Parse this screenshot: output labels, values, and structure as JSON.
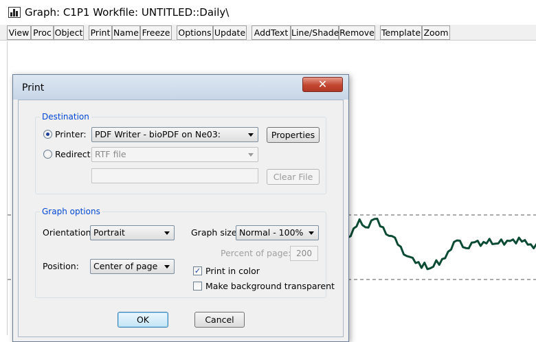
{
  "window": {
    "title": "Graph: C1P1   Workfile: UNTITLED::Daily\\"
  },
  "toolbar": {
    "buttons": [
      "View",
      "Proc",
      "Object",
      "Print",
      "Name",
      "Freeze",
      "Options",
      "Update",
      "AddText",
      "Line/Shade",
      "Remove",
      "Template",
      "Zoom"
    ]
  },
  "chart_data": {
    "type": "line",
    "series": [
      {
        "values": [
          0.55,
          0.62,
          0.7,
          0.78,
          0.85,
          0.8,
          0.72,
          0.76,
          0.83,
          0.9,
          0.86,
          0.78,
          0.72,
          0.65,
          0.58,
          0.62,
          0.55,
          0.48,
          0.4,
          0.32,
          0.25,
          0.28,
          0.22,
          0.18,
          0.15,
          0.1,
          0.14,
          0.08,
          0.05,
          0.12,
          0.18,
          0.15,
          0.2,
          0.26,
          0.32,
          0.4,
          0.48,
          0.55,
          0.5,
          0.44,
          0.38,
          0.42,
          0.47,
          0.52,
          0.5,
          0.46,
          0.48,
          0.5,
          0.53,
          0.49,
          0.45,
          0.5,
          0.52,
          0.48,
          0.5,
          0.54,
          0.52,
          0.5,
          0.55,
          0.53,
          0.51,
          0.48,
          0.44,
          0.42,
          0.45
        ]
      }
    ],
    "reference_lines": "dashed",
    "line_color": "#0b4a33",
    "grid": false
  },
  "dialog": {
    "title": "Print",
    "close_glyph": "✕",
    "destination": {
      "label": "Destination",
      "printer_label": "Printer:",
      "printer_value": "PDF Writer - bioPDF on Ne03:",
      "properties_button": "Properties",
      "redirect_label": "Redirect:",
      "redirect_value": "RTF file",
      "file_path": "",
      "clear_file_button": "Clear File"
    },
    "graph_options": {
      "label": "Graph options",
      "orientation_label": "Orientation:",
      "orientation_value": "Portrait",
      "graph_size_label": "Graph size:",
      "graph_size_value": "Normal - 100%",
      "percent_label": "Percent of page:",
      "percent_value": "200",
      "position_label": "Position:",
      "position_value": "Center of page",
      "print_in_color_label": "Print in color",
      "print_in_color_checked": true,
      "transparent_label": "Make background transparent",
      "transparent_checked": false
    },
    "ok_button": "OK",
    "cancel_button": "Cancel"
  }
}
